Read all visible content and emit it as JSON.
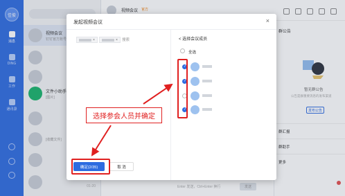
{
  "app": {
    "avatar_text": "佳俊",
    "rail_items": [
      "消息",
      "DING",
      "工作",
      "通讯录"
    ],
    "conversations": [
      {
        "title": "视频会议",
        "subtitle": "钉钉官方账号..."
      },
      {
        "title": "文件小助手",
        "subtitle": "[图片]"
      },
      {
        "title": "",
        "subtitle": "[收藏文件]"
      }
    ],
    "list_date": "01-20",
    "chat_title": "视频会议",
    "chat_tag": "官方",
    "input_hint": "Enter 发送，Ctrl+Enter 换行",
    "send_label": "发送"
  },
  "right_panel": {
    "title": "群公告",
    "empty_title": "暂无群公告",
    "empty_sub": "公告是群重要消息的发布渠道",
    "publish_label": "发布公告",
    "row_report": "群汇报",
    "row_assistant": "群助手",
    "row_more": "更多"
  },
  "dialog": {
    "title": "发起视频会议",
    "close": "×",
    "search_label": "搜索",
    "back_title": "< 选择会议成员",
    "select_all": "全选",
    "confirm_label": "确定(2/35)",
    "cancel_label": "取 消",
    "members_checked": [
      true,
      true,
      false,
      true
    ]
  },
  "annotation": {
    "callout_text": "选择参会人员并确定",
    "color": "#e02020"
  }
}
